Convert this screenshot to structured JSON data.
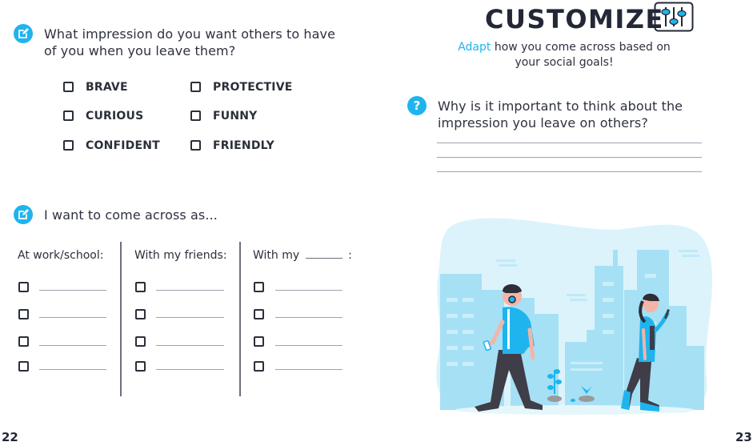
{
  "colors": {
    "accent": "#1fb4ee",
    "text": "#2b2f3a",
    "illustration_light": "#d8f2fb",
    "illustration_mid": "#a9e2f6"
  },
  "left_page": {
    "q1": {
      "icon": "edit-icon",
      "text_line1": "What impression do you want others to have",
      "text_line2": "of you when you leave them?",
      "options": [
        "BRAVE",
        "PROTECTIVE",
        "CURIOUS",
        "FUNNY",
        "CONFIDENT",
        "FRIENDLY"
      ]
    },
    "q2": {
      "icon": "edit-icon",
      "text": "I want to come across as...",
      "columns": [
        {
          "header": "At work/school:",
          "rows": 4
        },
        {
          "header": "With my friends:",
          "rows": 4
        },
        {
          "header": "With my",
          "header_suffix": ":",
          "rows": 4
        }
      ]
    },
    "page_number": "22"
  },
  "right_page": {
    "title": "CUSTOMIZE",
    "title_icon": "sliders-icon",
    "subtitle_accent": "Adapt",
    "subtitle_rest_line1": " how you come across based on",
    "subtitle_line2": "your social goals!",
    "question": {
      "icon": "question-icon",
      "text_line1": "Why is it important to think about the",
      "text_line2": "impression you leave on others?",
      "answer_lines": 3
    },
    "illustration": "city-walkers-illustration",
    "page_number": "23"
  }
}
